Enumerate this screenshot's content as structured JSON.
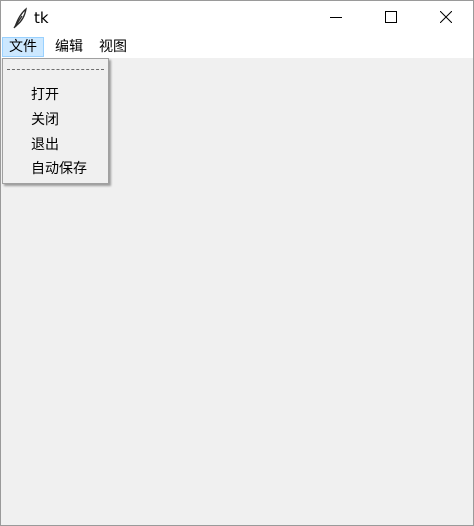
{
  "window": {
    "title": "tk",
    "icon": "feather-icon",
    "controls": [
      "minimize-icon",
      "maximize-icon",
      "close-icon"
    ]
  },
  "menubar": {
    "items": [
      {
        "label": "文件",
        "active": true
      },
      {
        "label": "编辑"
      },
      {
        "label": "视图"
      }
    ]
  },
  "file_menu": {
    "tearoff": true,
    "items": [
      {
        "label": "打开"
      },
      {
        "label": "关闭"
      },
      {
        "label": "退出"
      },
      {
        "label": "自动保存"
      }
    ]
  },
  "colors": {
    "client_background": "#f0f0f0",
    "menu_highlight": "#cce8ff",
    "menu_highlight_border": "#99d1ff"
  }
}
